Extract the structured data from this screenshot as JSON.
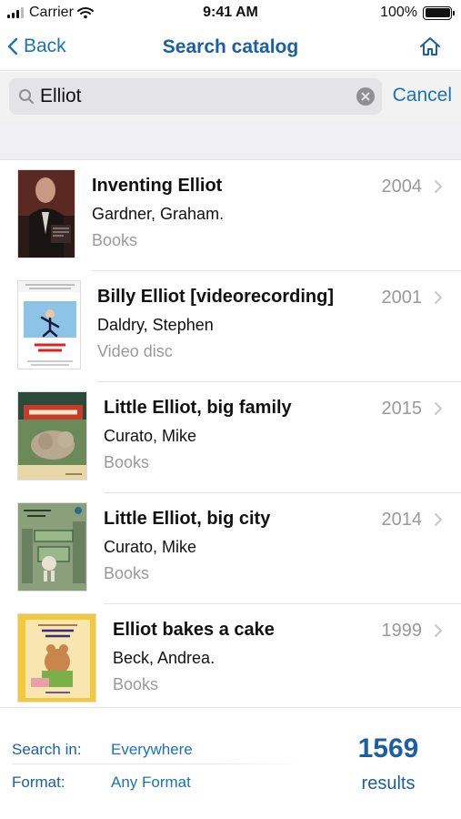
{
  "status_bar": {
    "carrier": "Carrier",
    "time": "9:41 AM",
    "battery": "100%",
    "battery_level": 1.0
  },
  "nav": {
    "back_label": "Back",
    "title": "Search catalog",
    "home_icon": "home-icon"
  },
  "search": {
    "value": "Elliot",
    "cancel_label": "Cancel"
  },
  "results": [
    {
      "title": "Inventing Elliot",
      "author": "Gardner, Graham.",
      "format": "Books",
      "year": "2004"
    },
    {
      "title": "Billy Elliot [videorecording]",
      "author": "Daldry, Stephen",
      "format": "Video disc",
      "year": "2001"
    },
    {
      "title": "Little Elliot, big family",
      "author": "Curato, Mike",
      "format": "Books",
      "year": "2015"
    },
    {
      "title": "Little Elliot, big city",
      "author": "Curato, Mike",
      "format": "Books",
      "year": "2014"
    },
    {
      "title": "Elliot bakes a cake",
      "author": "Beck, Andrea.",
      "format": "Books",
      "year": "1999"
    }
  ],
  "footer": {
    "search_in_label": "Search in:",
    "search_in_value": "Everywhere",
    "format_label": "Format:",
    "format_value": "Any Format",
    "count": "1569",
    "results_label": "results"
  },
  "colors": {
    "accent": "#1a73b8",
    "title_blue": "#1a5fa6",
    "muted": "#999999"
  }
}
